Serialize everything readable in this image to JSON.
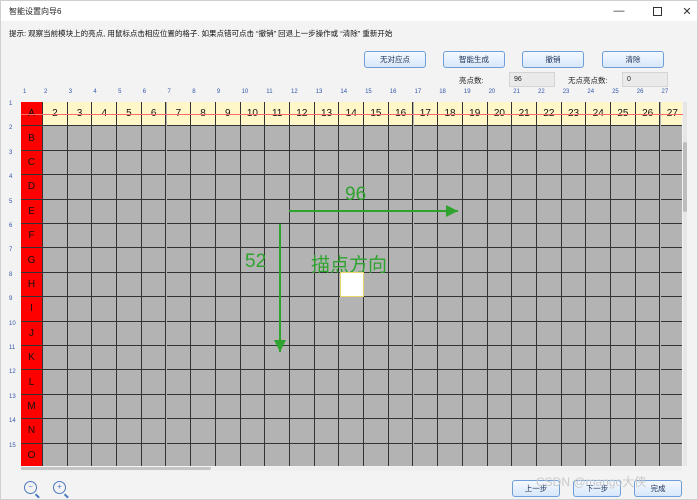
{
  "window": {
    "title": "智能设置向导6",
    "controls": {
      "minimize": "—",
      "close": "✕"
    }
  },
  "hint": "提示: 观察当前模块上的亮点, 用鼠标点击相应位置的格子. 如果点错可点击 “撤销” 回退上一步操作或 “清除” 重新开始",
  "toolbar": {
    "no_point_label": "无对应点",
    "smart_gen_label": "智能生成",
    "undo_label": "撤销",
    "clear_label": "清除"
  },
  "stats": {
    "lit_label": "亮点数:",
    "lit_value": "96",
    "unlit_label": "无点亮点数:",
    "unlit_value": "0"
  },
  "grid": {
    "col_numbers": [
      "1",
      "2",
      "3",
      "4",
      "5",
      "6",
      "7",
      "8",
      "9",
      "10",
      "11",
      "12",
      "13",
      "14",
      "15",
      "16",
      "17",
      "18",
      "19",
      "20",
      "21",
      "22",
      "23",
      "24",
      "25",
      "26",
      "27"
    ],
    "row_numbers": [
      "1",
      "2",
      "3",
      "4",
      "5",
      "6",
      "7",
      "8",
      "9",
      "10",
      "11",
      "12",
      "13",
      "14",
      "15"
    ],
    "header_numbers": [
      "2",
      "3",
      "4",
      "5",
      "6",
      "7",
      "8",
      "9",
      "10",
      "11",
      "12",
      "13",
      "14",
      "15",
      "16",
      "17",
      "18",
      "19",
      "20",
      "21",
      "22",
      "23",
      "24",
      "25",
      "26",
      "27"
    ],
    "row_letters": [
      "A",
      "B",
      "C",
      "D",
      "E",
      "F",
      "G",
      "H",
      "I",
      "J",
      "K",
      "L",
      "M",
      "N",
      "O"
    ]
  },
  "annotations": {
    "horizontal_count": "96",
    "vertical_count": "52",
    "direction_label": "描点方向"
  },
  "nav": {
    "prev_label": "上一步",
    "next_label": "下一步",
    "finish_label": "完成"
  },
  "watermark": "CSDN @mango大侠",
  "colors": {
    "row_header": "#ff0000",
    "column_header": "#fff7c8",
    "cell": "#b3b3b3",
    "annotation": "#2ea32e"
  }
}
